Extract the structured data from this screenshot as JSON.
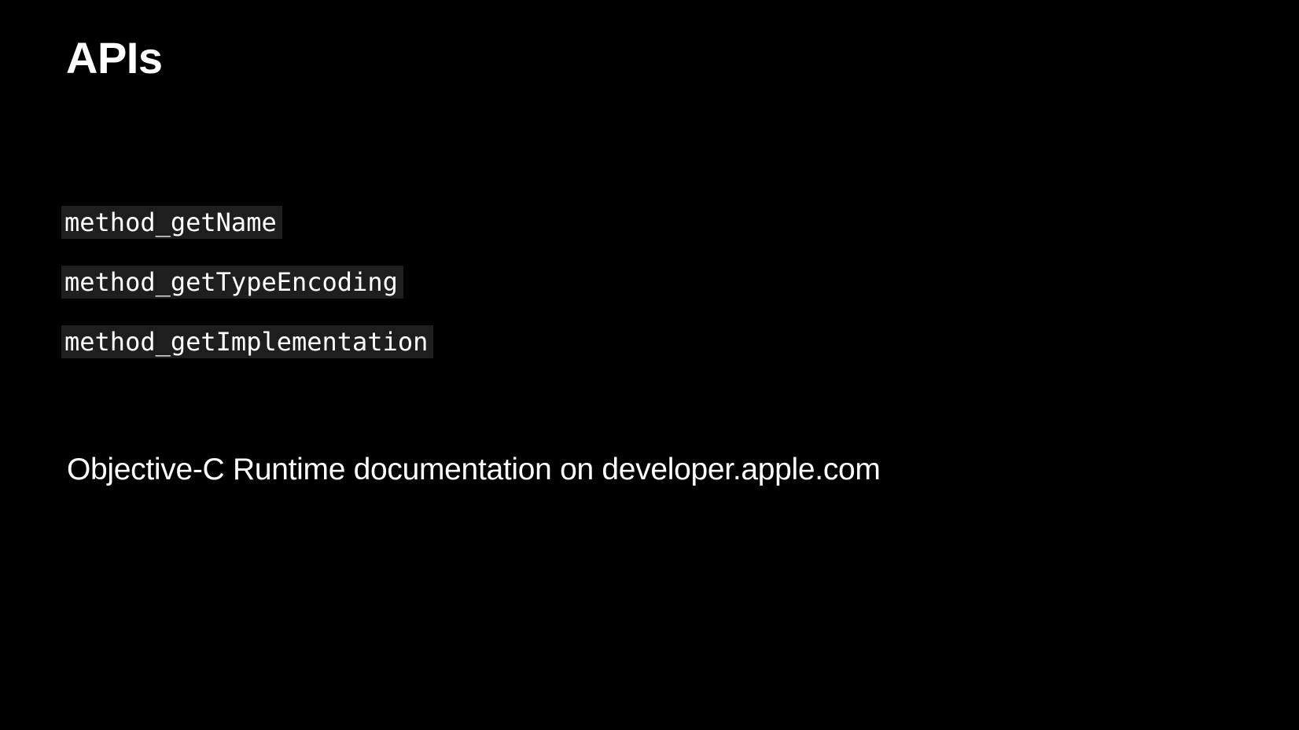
{
  "slide": {
    "title": "APIs",
    "apis": [
      "method_getName",
      "method_getTypeEncoding",
      "method_getImplementation"
    ],
    "footnote": "Objective-C Runtime documentation on developer.apple.com"
  },
  "colors": {
    "background": "#000000",
    "text": "#ffffff",
    "code_background": "#1e1e1e"
  }
}
